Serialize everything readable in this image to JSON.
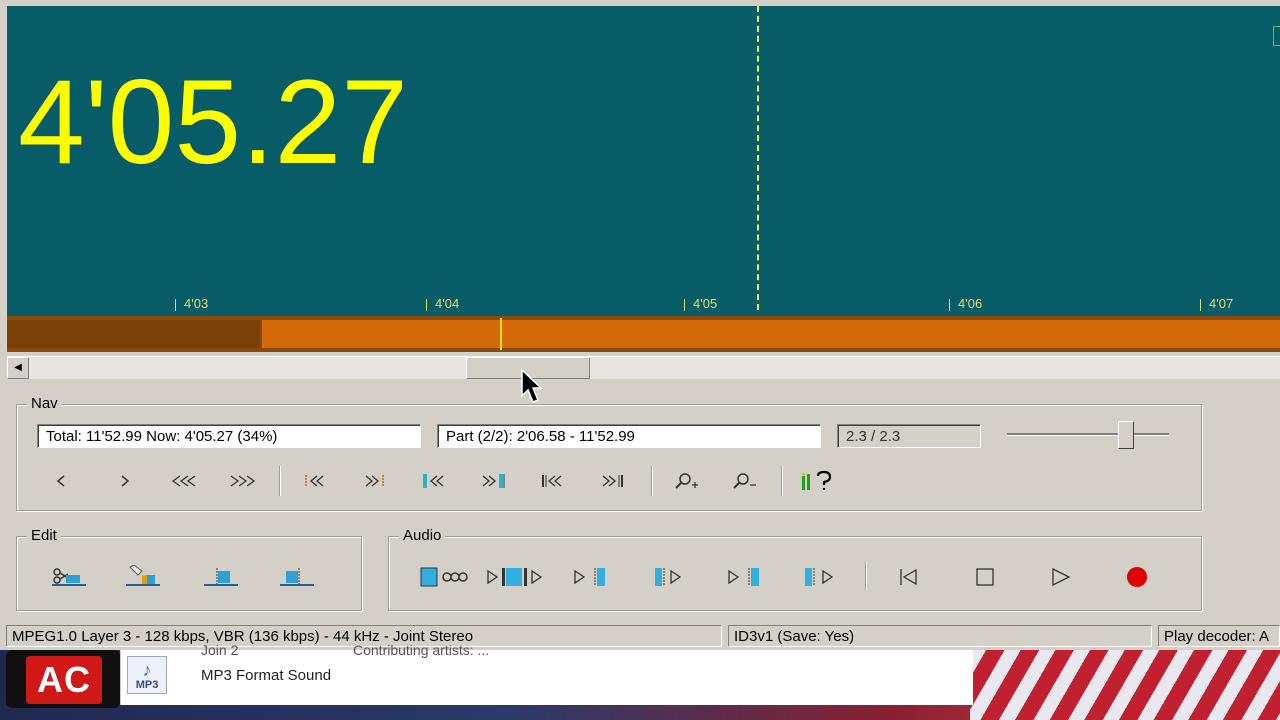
{
  "display": {
    "big_time": "4'05.27",
    "ticks": [
      "4'03",
      "4'04",
      "4'05",
      "4'06",
      "4'07"
    ]
  },
  "nav": {
    "label": "Nav",
    "total_now": "Total: 11'52.99   Now: 4'05.27   (34%)",
    "part": "Part (2/2): 2'06.58 - 11'52.99",
    "zoom_ratio": "2.3 / 2.3",
    "buttons": [
      "prev-frame",
      "next-frame",
      "rewind",
      "fast-forward",
      "go-part-start",
      "go-part-end",
      "prev-split",
      "next-split",
      "go-file-start",
      "go-file-end",
      "zoom-in",
      "zoom-out",
      "level-meter"
    ]
  },
  "edit": {
    "label": "Edit",
    "buttons": [
      "cut",
      "split",
      "mark-start",
      "mark-end"
    ]
  },
  "audio": {
    "label": "Audio",
    "buttons": [
      "loop-selection",
      "play-selection",
      "play-to-cursor",
      "play-from-cursor",
      "play-around-cursor",
      "play-after-split",
      "go-start",
      "stop",
      "play",
      "record"
    ]
  },
  "status": {
    "format": "MPEG1.0 Layer 3 - 128 kbps, VBR (136 kbps) - 44 kHz - Joint Stereo",
    "tag": "ID3v1 (Save: Yes)",
    "decoder": "Play decoder: A"
  },
  "explorer": {
    "file_type": "MP3 Format Sound",
    "icon_label": "MP3",
    "clip1": "Join 2",
    "clip2": "Contributing artists: ..."
  },
  "logo": {
    "text": "AC"
  },
  "colors": {
    "wave_bg": "#075c68",
    "time_text": "#fdfd00",
    "progress": "#d46a08",
    "record": "#e00000"
  },
  "progress": {
    "position_fraction": 0.34
  }
}
